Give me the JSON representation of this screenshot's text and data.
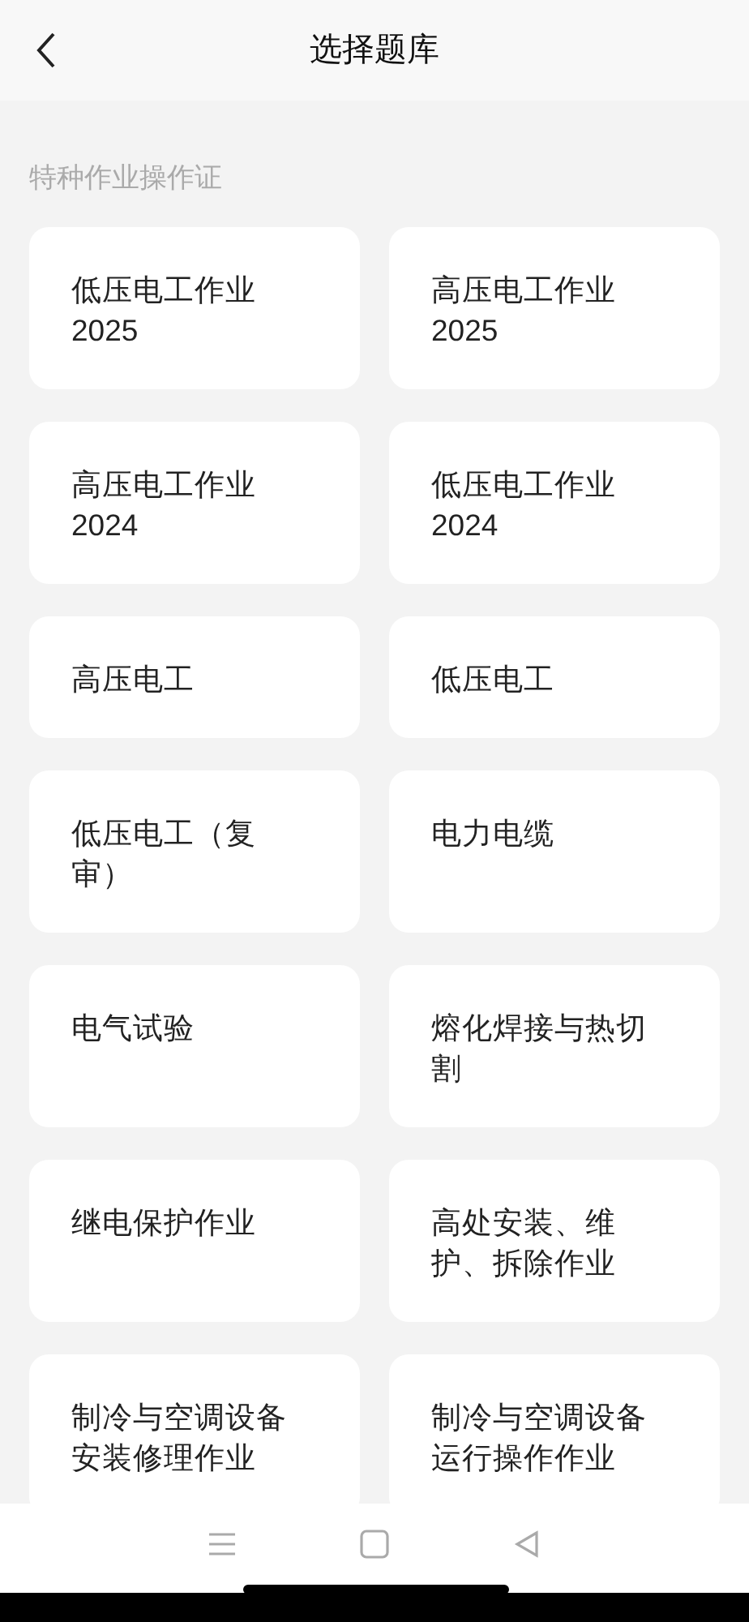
{
  "header": {
    "title": "选择题库"
  },
  "section": {
    "label": "特种作业操作证"
  },
  "cards": [
    {
      "lines": [
        "低压电工作业",
        "2025"
      ]
    },
    {
      "lines": [
        "高压电工作业",
        "2025"
      ]
    },
    {
      "lines": [
        "高压电工作业",
        "2024"
      ]
    },
    {
      "lines": [
        "低压电工作业",
        "2024"
      ]
    },
    {
      "lines": [
        "高压电工"
      ]
    },
    {
      "lines": [
        "低压电工"
      ]
    },
    {
      "lines": [
        "低压电工（复",
        "审）"
      ]
    },
    {
      "lines": [
        "电力电缆"
      ]
    },
    {
      "lines": [
        "电气试验"
      ]
    },
    {
      "lines": [
        "熔化焊接与热切",
        "割"
      ]
    },
    {
      "lines": [
        "继电保护作业"
      ]
    },
    {
      "lines": [
        "高处安装、维",
        "护、拆除作业"
      ]
    },
    {
      "lines": [
        "制冷与空调设备",
        "安装修理作业"
      ]
    },
    {
      "lines": [
        "制冷与空调设备",
        "运行操作作业"
      ]
    }
  ]
}
